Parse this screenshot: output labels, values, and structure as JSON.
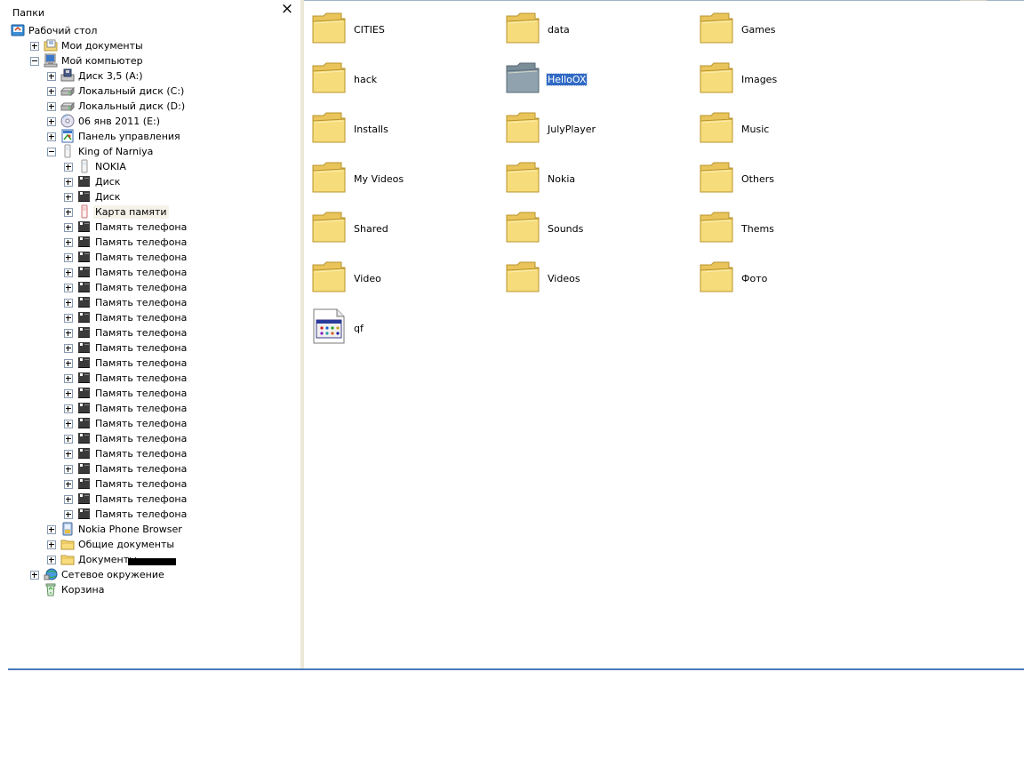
{
  "folders_pane": {
    "title": "Папки",
    "close_label": "×",
    "tree": [
      {
        "label": "Рабочий стол",
        "icon": "desktop-icon",
        "level": 0,
        "expander": "none"
      },
      {
        "label": "Мои документы",
        "icon": "my-documents-icon",
        "level": 1,
        "expander": "plus"
      },
      {
        "label": "Мой компьютер",
        "icon": "my-computer-icon",
        "level": 1,
        "expander": "minus"
      },
      {
        "label": "Диск 3,5 (A:)",
        "icon": "floppy-drive-icon",
        "level": 2,
        "expander": "plus"
      },
      {
        "label": "Локальный диск (C:)",
        "icon": "hard-drive-icon",
        "level": 2,
        "expander": "plus"
      },
      {
        "label": "Локальный диск (D:)",
        "icon": "hard-drive-icon",
        "level": 2,
        "expander": "plus"
      },
      {
        "label": "06 янв 2011 (E:)",
        "icon": "cd-drive-icon",
        "level": 2,
        "expander": "plus"
      },
      {
        "label": "Панель управления",
        "icon": "control-panel-icon",
        "level": 2,
        "expander": "plus"
      },
      {
        "label": "King of Narniya",
        "icon": "phone-icon",
        "level": 2,
        "expander": "minus"
      },
      {
        "label": "NOKIA",
        "icon": "phone-icon",
        "level": 3,
        "expander": "plus"
      },
      {
        "label": "Диск",
        "icon": "memory-card-icon",
        "level": 3,
        "expander": "plus"
      },
      {
        "label": "Диск",
        "icon": "memory-card-icon",
        "level": 3,
        "expander": "plus"
      },
      {
        "label": "Карта памяти",
        "icon": "red-phone-icon",
        "level": 3,
        "expander": "plus",
        "highlight": true
      },
      {
        "label": "Память телефона",
        "icon": "memory-card-icon",
        "level": 3,
        "expander": "plus"
      },
      {
        "label": "Память телефона",
        "icon": "memory-card-icon",
        "level": 3,
        "expander": "plus"
      },
      {
        "label": "Память телефона",
        "icon": "memory-card-icon",
        "level": 3,
        "expander": "plus"
      },
      {
        "label": "Память телефона",
        "icon": "memory-card-icon",
        "level": 3,
        "expander": "plus"
      },
      {
        "label": "Память телефона",
        "icon": "memory-card-icon",
        "level": 3,
        "expander": "plus"
      },
      {
        "label": "Память телефона",
        "icon": "memory-card-icon",
        "level": 3,
        "expander": "plus"
      },
      {
        "label": "Память телефона",
        "icon": "memory-card-icon",
        "level": 3,
        "expander": "plus"
      },
      {
        "label": "Память телефона",
        "icon": "memory-card-icon",
        "level": 3,
        "expander": "plus"
      },
      {
        "label": "Память телефона",
        "icon": "memory-card-icon",
        "level": 3,
        "expander": "plus"
      },
      {
        "label": "Память телефона",
        "icon": "memory-card-icon",
        "level": 3,
        "expander": "plus"
      },
      {
        "label": "Память телефона",
        "icon": "memory-card-icon",
        "level": 3,
        "expander": "plus"
      },
      {
        "label": "Память телефона",
        "icon": "memory-card-icon",
        "level": 3,
        "expander": "plus"
      },
      {
        "label": "Память телефона",
        "icon": "memory-card-icon",
        "level": 3,
        "expander": "plus"
      },
      {
        "label": "Память телефона",
        "icon": "memory-card-icon",
        "level": 3,
        "expander": "plus"
      },
      {
        "label": "Память телефона",
        "icon": "memory-card-icon",
        "level": 3,
        "expander": "plus"
      },
      {
        "label": "Память телефона",
        "icon": "memory-card-icon",
        "level": 3,
        "expander": "plus"
      },
      {
        "label": "Память телефона",
        "icon": "memory-card-icon",
        "level": 3,
        "expander": "plus"
      },
      {
        "label": "Память телефона",
        "icon": "memory-card-icon",
        "level": 3,
        "expander": "plus"
      },
      {
        "label": "Память телефона",
        "icon": "memory-card-icon",
        "level": 3,
        "expander": "plus"
      },
      {
        "label": "Память телефона",
        "icon": "memory-card-icon",
        "level": 3,
        "expander": "plus"
      },
      {
        "label": "Nokia Phone Browser",
        "icon": "nokia-browser-icon",
        "level": 2,
        "expander": "plus"
      },
      {
        "label": "Общие документы",
        "icon": "folder-icon",
        "level": 2,
        "expander": "plus"
      },
      {
        "label": "Документы -",
        "icon": "folder-icon",
        "level": 2,
        "expander": "plus"
      },
      {
        "label": "Сетевое окружение",
        "icon": "network-icon",
        "level": 1,
        "expander": "plus"
      },
      {
        "label": "Корзина",
        "icon": "recycle-bin-icon",
        "level": 1,
        "expander": "none"
      }
    ]
  },
  "content": {
    "items": [
      {
        "label": "CITIES",
        "icon": "folder-icon"
      },
      {
        "label": "data",
        "icon": "folder-icon"
      },
      {
        "label": "Games",
        "icon": "folder-icon"
      },
      {
        "label": "hack",
        "icon": "folder-icon"
      },
      {
        "label": "HelloOX",
        "icon": "folder-icon",
        "selected": true
      },
      {
        "label": "Images",
        "icon": "folder-icon"
      },
      {
        "label": "Installs",
        "icon": "folder-icon"
      },
      {
        "label": "JulyPlayer",
        "icon": "folder-icon"
      },
      {
        "label": "Music",
        "icon": "folder-icon"
      },
      {
        "label": "My Videos",
        "icon": "folder-icon"
      },
      {
        "label": "Nokia",
        "icon": "folder-icon"
      },
      {
        "label": "Others",
        "icon": "folder-icon"
      },
      {
        "label": "Shared",
        "icon": "folder-icon"
      },
      {
        "label": "Sounds",
        "icon": "folder-icon"
      },
      {
        "label": "Thems",
        "icon": "folder-icon"
      },
      {
        "label": "Video",
        "icon": "folder-icon"
      },
      {
        "label": "Videos",
        "icon": "folder-icon"
      },
      {
        "label": "Фото",
        "icon": "folder-icon"
      },
      {
        "label": "qf",
        "icon": "application-file-icon"
      }
    ]
  },
  "colors": {
    "selection": "#316ac5",
    "folder_yellow": "#f6dc7a",
    "folder_selected": "#8a9ba8",
    "divider_blue": "#4a7ab8"
  }
}
